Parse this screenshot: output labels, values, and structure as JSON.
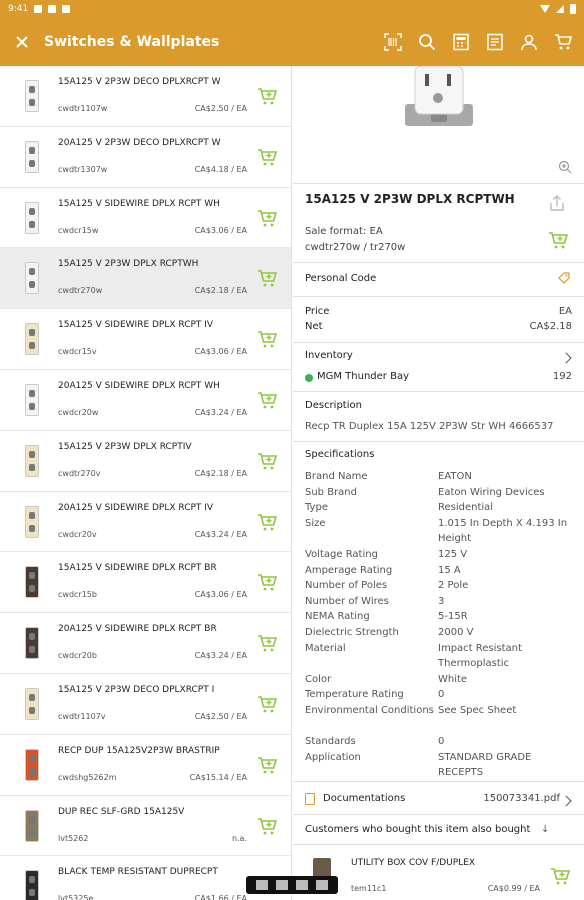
{
  "status_bar": {
    "time": "9:41"
  },
  "app_bar": {
    "title": "Switches & Wallplates",
    "colors": {
      "accent": "#DA9A2C",
      "icon": "#ffffff"
    },
    "actions": [
      "barcode-scan-icon",
      "search-icon",
      "calculator-icon",
      "order-pad-icon",
      "account-icon",
      "cart-icon"
    ]
  },
  "list": {
    "items": [
      {
        "title": "15A125 V 2P3W DECO DPLXRCPT W",
        "code": "cwdtr1107w",
        "price": "CA$2.50 / EA",
        "color": "#f3f3f3"
      },
      {
        "title": "20A125 V 2P3W DECO DPLXRCPT W",
        "code": "cwdtr1307w",
        "price": "CA$4.18 / EA",
        "color": "#f3f3f3"
      },
      {
        "title": "15A125 V SIDEWIRE DPLX RCPT WH",
        "code": "cwdcr15w",
        "price": "CA$3.06 / EA",
        "color": "#f3f3f3"
      },
      {
        "title": "15A125 V 2P3W DPLX RCPTWH",
        "code": "cwdtr270w",
        "price": "CA$2.18 / EA",
        "color": "#f3f3f3",
        "selected": true
      },
      {
        "title": "15A125 V SIDEWIRE DPLX RCPT IV",
        "code": "cwdcr15v",
        "price": "CA$3.06 / EA",
        "color": "#efe3c4"
      },
      {
        "title": "20A125 V SIDEWIRE DPLX RCPT WH",
        "code": "cwdcr20w",
        "price": "CA$3.24 / EA",
        "color": "#f3f3f3"
      },
      {
        "title": "15A125 V 2P3W DPLX RCPTIV",
        "code": "cwdtr270v",
        "price": "CA$2.18 / EA",
        "color": "#efe3c4"
      },
      {
        "title": "20A125 V SIDEWIRE DPLX RCPT IV",
        "code": "cwdcr20v",
        "price": "CA$3.24 / EA",
        "color": "#efe3c4"
      },
      {
        "title": "15A125 V SIDEWIRE DPLX RCPT BR",
        "code": "cwdcr15b",
        "price": "CA$3.06 / EA",
        "color": "#4a3a32"
      },
      {
        "title": "20A125 V SIDEWIRE DPLX RCPT BR",
        "code": "cwdcr20b",
        "price": "CA$3.24 / EA",
        "color": "#4a3a32"
      },
      {
        "title": "15A125 V 2P3W DECO DPLXRCPT I",
        "code": "cwdtr1107v",
        "price": "CA$2.50 / EA",
        "color": "#efe3c4"
      },
      {
        "title": "RECP DUP 15A125V2P3W BRASTRIP",
        "code": "cwdshg5262m",
        "price": "CA$15.14 / EA",
        "color": "#d8542a"
      },
      {
        "title": "DUP REC SLF-GRD 15A125V",
        "code": "lvt5262",
        "price": "n.a.",
        "color": "#8a7a5a"
      },
      {
        "title": "BLACK TEMP RESISTANT DUPRECPT",
        "code": "lvt5325e",
        "price": "CA$1.66 / EA",
        "color": "#2a2a2a"
      }
    ]
  },
  "detail": {
    "title": "15A125 V 2P3W DPLX RCPTWH",
    "sale_format": "Sale format: EA",
    "codes": "cwdtr270w / tr270w",
    "personal_code_label": "Personal Code",
    "price_label": "Price",
    "price_unit": "EA",
    "net_label": "Net",
    "net_value": "CA$2.18",
    "inventory_label": "Inventory",
    "inventory_location": "MGM Thunder Bay",
    "inventory_count": "192",
    "description_label": "Description",
    "description": "Recp TR Duplex 15A 125V 2P3W Str WH 4666537",
    "specifications_label": "Specifications",
    "specs": [
      {
        "key": "Brand Name",
        "value": "EATON"
      },
      {
        "key": "Sub Brand",
        "value": "Eaton Wiring Devices"
      },
      {
        "key": "Type",
        "value": "Residential"
      },
      {
        "key": "Size",
        "value": "1.015 In Depth X 4.193 In Height"
      },
      {
        "key": "Voltage Rating",
        "value": "125 V"
      },
      {
        "key": "Amperage Rating",
        "value": "15 A"
      },
      {
        "key": "Number of Poles",
        "value": "2 Pole"
      },
      {
        "key": "Number of Wires",
        "value": "3"
      },
      {
        "key": "NEMA Rating",
        "value": "5-15R"
      },
      {
        "key": "Dielectric Strength",
        "value": "2000 V"
      },
      {
        "key": "Material",
        "value": "Impact Resistant Thermoplastic"
      },
      {
        "key": "Color",
        "value": "White"
      },
      {
        "key": "Temperature Rating",
        "value": "0"
      },
      {
        "key": "Environmental Conditions",
        "value": "See Spec Sheet"
      },
      {
        "key": "Standards",
        "value": "0"
      },
      {
        "key": "Application",
        "value": "STANDARD GRADE RECEPTS"
      }
    ],
    "documentations_label": "Documentations",
    "documentation_file": "150073341.pdf",
    "also_bought_label": "Customers who bought this item also bought",
    "also_bought_item": {
      "title": "UTILITY BOX COV F/DUPLEX",
      "code": "tem11c1",
      "price": "CA$0.99 / EA"
    },
    "colors": {
      "available": "#36b34a",
      "cart": "#8dc63f"
    }
  }
}
